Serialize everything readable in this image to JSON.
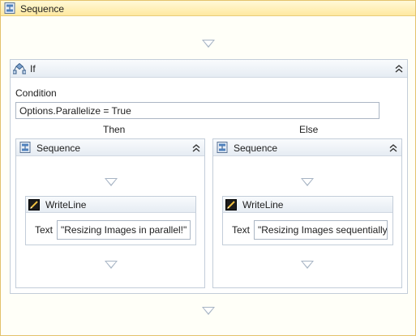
{
  "root_sequence": {
    "title": "Sequence",
    "icon": "sequence-icon"
  },
  "if_activity": {
    "title": "If",
    "icon": "if-activity-icon",
    "condition_label": "Condition",
    "condition_value": "Options.Parallelize = True",
    "then_label": "Then",
    "else_label": "Else"
  },
  "then_branch": {
    "sequence_title": "Sequence",
    "writeline_title": "WriteLine",
    "text_label": "Text",
    "text_value": "\"Resizing Images in parallel!\""
  },
  "else_branch": {
    "sequence_title": "Sequence",
    "writeline_title": "WriteLine",
    "text_label": "Text",
    "text_value": "\"Resizing Images sequentially"
  },
  "colors": {
    "root_header": "#ffe9a0",
    "root_border": "#e3c26c",
    "container_border": "#c3cdd9",
    "drop_arrow": "#a7b4c4"
  }
}
